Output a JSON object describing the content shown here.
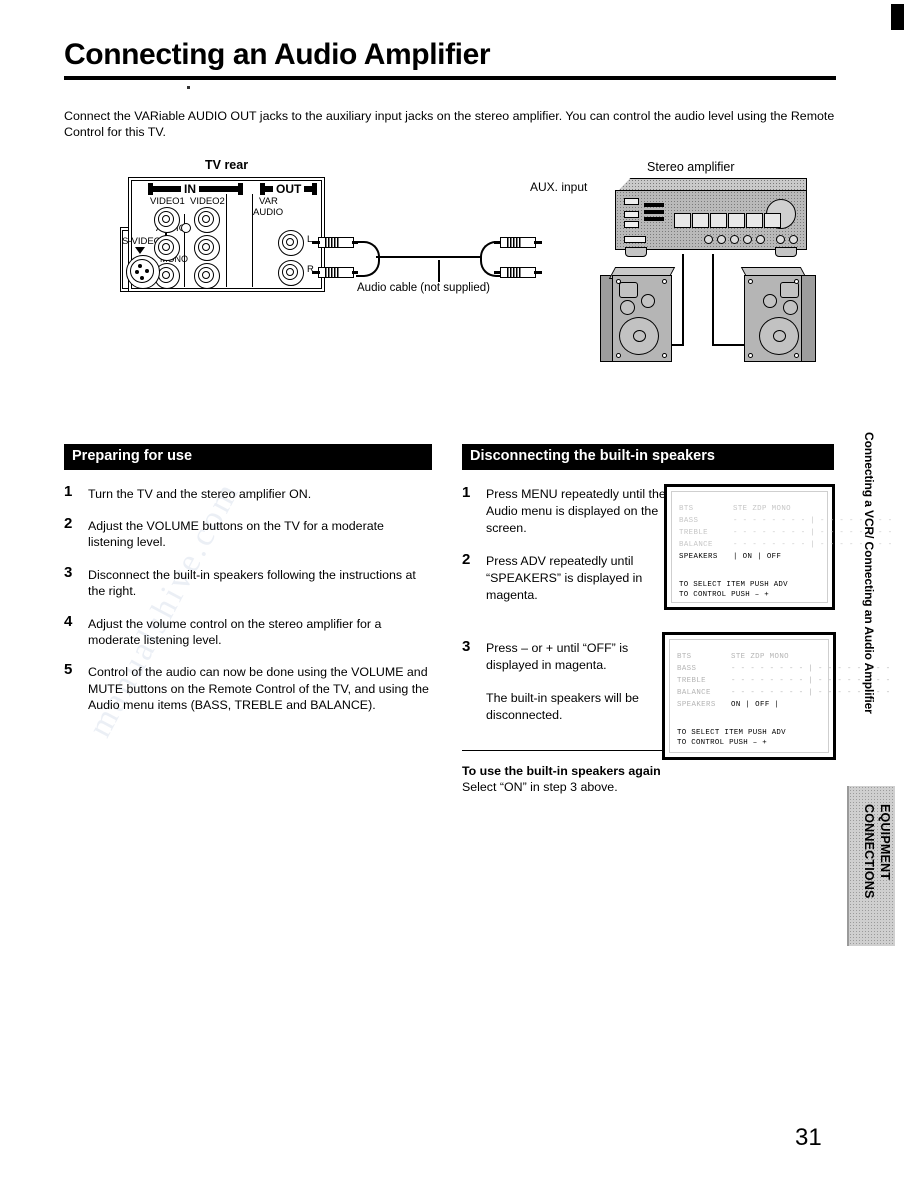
{
  "document": {
    "title": "Connecting an Audio Amplifier",
    "intro": "Connect the VARiable AUDIO OUT jacks to the auxiliary input jacks on the stereo amplifier. You can control the audio level using the Remote Control for this TV.",
    "page_number": "31",
    "watermark": "manualshive.com"
  },
  "diagram": {
    "tv_rear_label": "TV rear",
    "in_label": "IN",
    "out_label": "OUT",
    "video1_label": "VIDEO1",
    "video2_label": "VIDEO2",
    "var_label": "VAR",
    "audio_out_label": "AUDIO",
    "audio_in_label": "AUDIO",
    "svideo_label": "S-VIDEO",
    "l_mono_label": "L/",
    "mono_label": "MONO",
    "r_label": "R",
    "out_l_label": "L",
    "out_r_label": "R",
    "aux_input_label": "AUX. input",
    "amplifier_label": "Stereo amplifier",
    "cable_label": "Audio cable (not supplied)"
  },
  "left_column": {
    "heading": "Preparing for use",
    "steps": [
      {
        "num": "1",
        "text": "Turn the TV and the stereo amplifier ON."
      },
      {
        "num": "2",
        "text": "Adjust the VOLUME buttons on the TV for a moderate listening level."
      },
      {
        "num": "3",
        "text": "Disconnect the built-in speakers following the instructions at the right."
      },
      {
        "num": "4",
        "text": "Adjust the volume control on the stereo amplifier for a moderate listening level."
      },
      {
        "num": "5",
        "text": "Control of the audio can now be done using the VOLUME and MUTE buttons on the Remote Control of  the TV, and using the Audio menu items (BASS, TREBLE and BALANCE)."
      }
    ]
  },
  "right_column": {
    "heading": "Disconnecting the built-in speakers",
    "steps": [
      {
        "num": "1",
        "text": "Press MENU repeatedly until the Audio menu is displayed on the screen."
      },
      {
        "num": "2",
        "text": "Press ADV repeatedly until “SPEAKERS” is displayed in magenta."
      },
      {
        "num": "3",
        "text": "Press – or + until “OFF” is displayed in magenta."
      }
    ],
    "note": "The built-in speakers will be disconnected.",
    "footnote_title": "To use the built-in speakers again",
    "footnote_text": "Select “ON” in step 3 above."
  },
  "osd_screens": [
    {
      "rows": [
        {
          "label": "BTS",
          "value": "STE  ZDP  MONO"
        },
        {
          "label": "BASS",
          "value": "- - - - - - - - | - - - - - - - -"
        },
        {
          "label": "TREBLE",
          "value": "- - - - - - - - | - - - - - - - -"
        },
        {
          "label": "BALANCE",
          "value": "- - - - - - - - | - - - - - - - -"
        },
        {
          "label": "SPEAKERS",
          "value": "| ON | OFF"
        }
      ],
      "footer_line1": "TO SELECT ITEM PUSH ADV",
      "footer_line2": "TO CONTROL PUSH –  +"
    },
    {
      "rows": [
        {
          "label": "BTS",
          "value": "STE  ZDP  MONO"
        },
        {
          "label": "BASS",
          "value": "- - - - - - - - | - - - - - - - -"
        },
        {
          "label": "TREBLE",
          "value": "- - - - - - - - | - - - - - - - -"
        },
        {
          "label": "BALANCE",
          "value": "- - - - - - - - | - - - - - - - -"
        },
        {
          "label": "SPEAKERS",
          "value": "ON | OFF |"
        }
      ],
      "footer_line1": "TO SELECT ITEM PUSH ADV",
      "footer_line2": "TO CONTROL PUSH –  +"
    }
  ],
  "side_tabs": {
    "running_head": "Connecting a VCR/ Connecting an Audio Amplifier",
    "section_tab": "EQUIPMENT\nCONNECTIONS"
  }
}
